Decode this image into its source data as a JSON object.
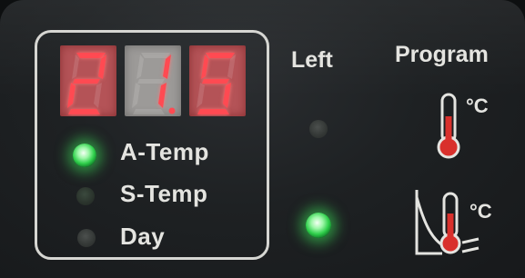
{
  "display": {
    "digits": [
      "2",
      "1",
      "5"
    ],
    "decimal_after_index": 1,
    "value": "21.5",
    "color_on": "#ff4a52"
  },
  "indicators": [
    {
      "label": "A-Temp",
      "state": "on"
    },
    {
      "label": "S-Temp",
      "state": "off"
    },
    {
      "label": "Day",
      "state": "off"
    }
  ],
  "headers": {
    "left": "Left",
    "program": "Program"
  },
  "left_leds": [
    {
      "state": "off"
    },
    {
      "state": "on"
    }
  ],
  "program_icons": [
    {
      "icon": "thermometer-icon",
      "unit": "°C"
    },
    {
      "icon": "heating-curve-thermometer-icon",
      "unit": "°C"
    }
  ],
  "colors": {
    "led_green": "#3be25a",
    "thermometer_red": "#d9302c",
    "frame": "#d6d6d2"
  }
}
